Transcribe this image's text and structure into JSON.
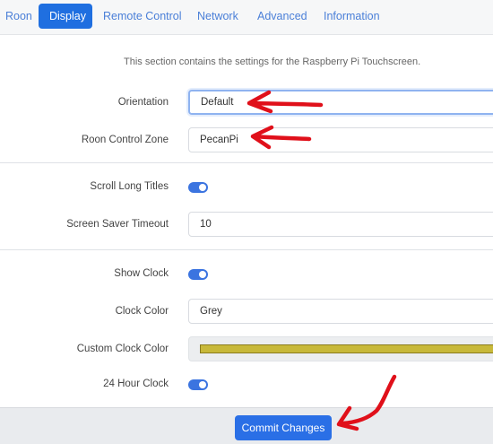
{
  "tabs": [
    {
      "label": "Roon",
      "active": false
    },
    {
      "label": "Display",
      "active": true
    },
    {
      "label": "Remote Control",
      "active": false
    },
    {
      "label": "Network",
      "active": false
    },
    {
      "label": "Advanced",
      "active": false
    },
    {
      "label": "Information",
      "active": false
    }
  ],
  "intro": "This section contains the settings for the Raspberry Pi Touchscreen.",
  "fields": {
    "orientation": {
      "label": "Orientation",
      "value": "Default"
    },
    "zone": {
      "label": "Roon Control Zone",
      "value": "PecanPi"
    },
    "scroll": {
      "label": "Scroll Long Titles",
      "on": true
    },
    "screensaver": {
      "label": "Screen Saver Timeout",
      "value": "10"
    },
    "show_clock": {
      "label": "Show Clock",
      "on": true
    },
    "clock_color": {
      "label": "Clock Color",
      "value": "Grey"
    },
    "custom_clock_color": {
      "label": "Custom Clock Color",
      "color": "#c8b93a"
    },
    "hour24": {
      "label": "24 Hour Clock",
      "on": true
    }
  },
  "commit_label": "Commit Changes",
  "colors": {
    "accent": "#2a6fe6",
    "toggle_on": "#3b74e0",
    "annotation": "#e0101a"
  },
  "annotations": [
    "red-arrow",
    "red-arrow",
    "red-arrow"
  ]
}
